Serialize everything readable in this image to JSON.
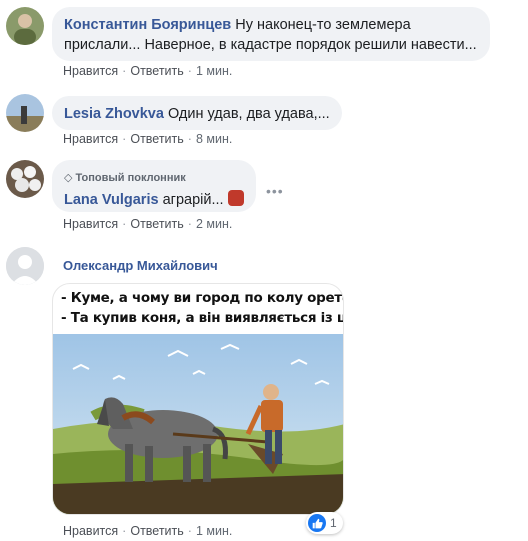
{
  "comments": [
    {
      "author": "Константин Бояринцев",
      "text_line1": "Ну наконец-то землемера",
      "text_line2": "прислали... Наверное, в кадастре порядок решили навести...",
      "like": "Нравится",
      "reply": "Ответить",
      "time": "1 мин."
    },
    {
      "author": "Lesia Zhovkva",
      "text": "Один удав, два удава,...",
      "like": "Нравится",
      "reply": "Ответить",
      "time": "8 мин."
    },
    {
      "badge": "Топовый поклонник",
      "author": "Lana Vulgaris",
      "text": "аграрій...",
      "like": "Нравится",
      "reply": "Ответить",
      "time": "2 мин."
    },
    {
      "author": "Олександр Михайлович",
      "image_caption_line1": "- Куме, а чому ви город по колу орете?",
      "image_caption_line2": "- Та купив коня, а він виявляється із цирку.",
      "like": "Нравится",
      "reply": "Ответить",
      "time": "1 мин.",
      "reaction_count": "1"
    }
  ],
  "colors": {
    "author": "#385898",
    "bubble": "#f0f2f5",
    "like_reaction": "#1877f2"
  },
  "icons": [
    "more-options-icon",
    "diamond-badge-icon",
    "like-reaction-icon",
    "devil-emoji-icon"
  ]
}
